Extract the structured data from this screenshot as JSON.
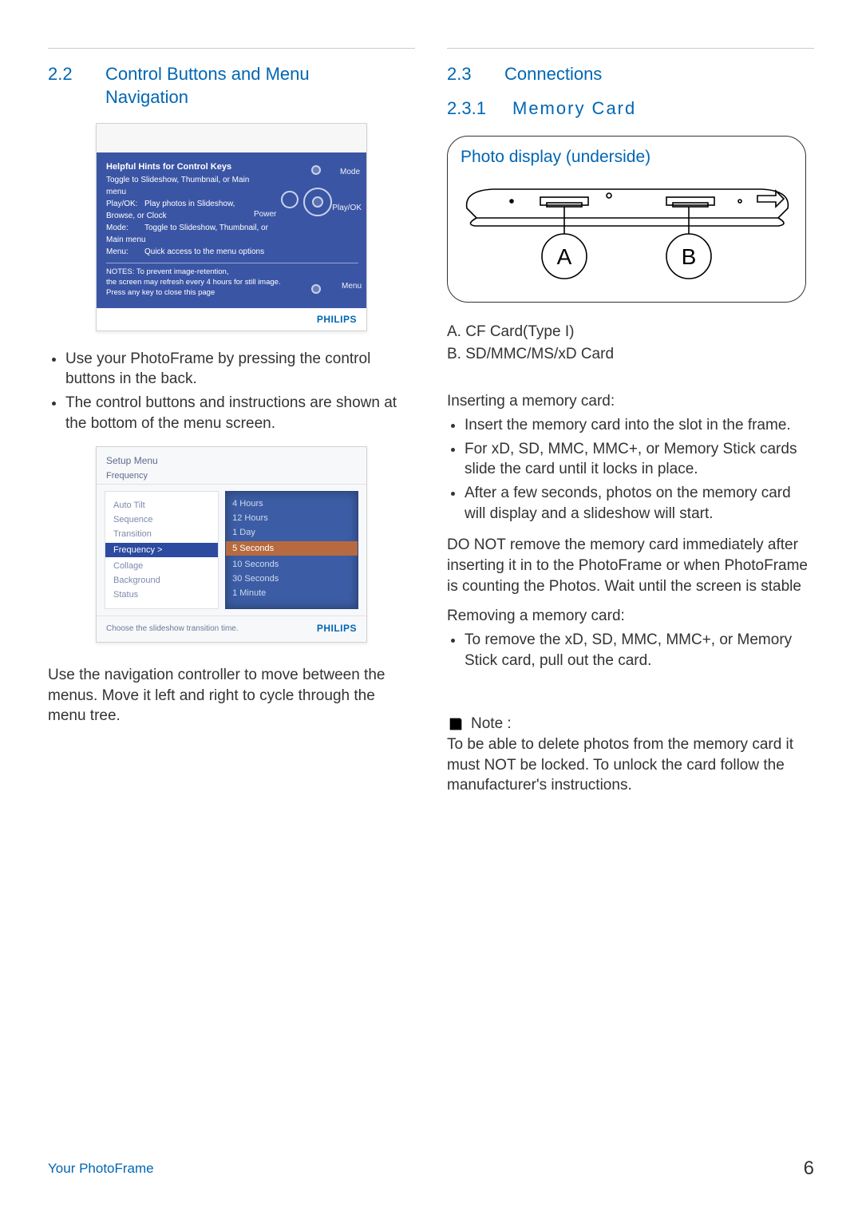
{
  "left": {
    "section_num": "2.2",
    "section_title": "Control Buttons and Menu Navigation",
    "ss1": {
      "title": "Helpful Hints for Control Keys",
      "line1": "Toggle to Slideshow, Thumbnail, or Main menu",
      "line2_label": "Play/OK:",
      "line2_text": "Play photos in Slideshow, Browse, or Clock",
      "line3_label": "Mode:",
      "line3_text": "Toggle to Slideshow, Thumbnail, or Main menu",
      "line4_label": "Menu:",
      "line4_text": "Quick access to the menu options",
      "note1": "NOTES: To prevent image-retention,",
      "note2": "the screen may refresh every 4 hours for still image.",
      "note3": "Press any key to close this page",
      "mode": "Mode",
      "play": "Play/OK",
      "menu": "Menu",
      "power": "Power",
      "logo": "PHILIPS"
    },
    "bullets1": [
      "Use your PhotoFrame by pressing the control buttons in the back.",
      "The control buttons and instructions are shown at the bottom of the menu screen."
    ],
    "ss2": {
      "title": "Setup Menu",
      "sub": "Frequency",
      "left_items_pre": [
        "Auto Tilt",
        "Sequence",
        "Transition"
      ],
      "left_sel": "Frequency >",
      "left_items_post": [
        "Collage",
        "Background",
        "Status"
      ],
      "right_items_pre": [
        "4 Hours",
        "12 Hours",
        "1 Day"
      ],
      "right_sel": "5 Seconds",
      "right_items_post": [
        "10 Seconds",
        "30 Seconds",
        "1 Minute"
      ],
      "caption": "Choose the slideshow transition time.",
      "logo": "PHILIPS"
    },
    "para1": "Use the navigation controller to move between the menus. Move it left  and right  to cycle through the menu tree."
  },
  "right": {
    "sec1_num": "2.3",
    "sec1_title": "Connections",
    "sec2_num": "2.3.1",
    "sec2_title": "Memory Card",
    "diagram_title": "Photo display (underside)",
    "labelA": "A",
    "labelB": "B",
    "list_a": "A. CF Card(Type I)",
    "list_b": "B. SD/MMC/MS/xD Card",
    "insert_title": "Inserting a memory card:",
    "insert_bullets": [
      "Insert the memory card into the slot in the frame.",
      "For xD, SD, MMC, MMC+, or Memory Stick cards slide the card until it locks in place.",
      "After a few seconds, photos on the memory card will display and a slideshow will start."
    ],
    "warning": "DO NOT remove the memory card immediately after inserting it in to the PhotoFrame or when PhotoFrame is counting the Photos. Wait until the screen is stable",
    "remove_title": "Removing a memory card:",
    "remove_bullets": [
      "To remove the xD, SD, MMC, MMC+, or Memory Stick card, pull out the card."
    ],
    "note_label": "Note :",
    "note_text": "To be able to delete photos from the memory card it must NOT be locked. To unlock the card follow the manufacturer's instructions."
  },
  "footer": {
    "left": "Your PhotoFrame",
    "page": "6"
  }
}
